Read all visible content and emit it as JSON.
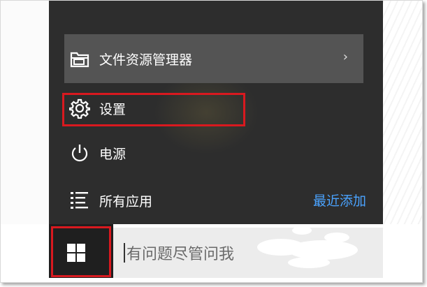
{
  "start_menu": {
    "items": [
      {
        "label": "文件资源管理器",
        "icon": "folder-icon",
        "chevron": "›"
      },
      {
        "label": "设置",
        "icon": "gear-icon"
      },
      {
        "label": "电源",
        "icon": "power-icon"
      },
      {
        "label": "所有应用",
        "icon": "list-icon"
      }
    ],
    "recently_added": "最近添加"
  },
  "taskbar": {
    "start_icon": "windows-logo-icon",
    "search_placeholder": "有问题尽管问我"
  },
  "highlight_color": "#d9191f",
  "accent_color": "#4aa3ff"
}
